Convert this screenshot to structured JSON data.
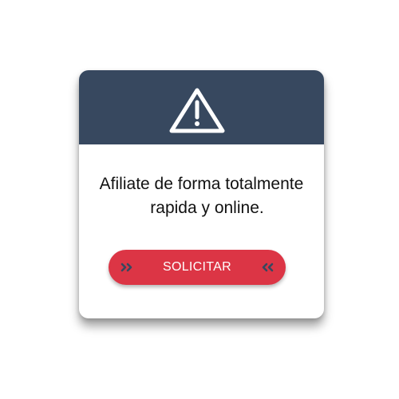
{
  "dialog": {
    "header_icon": "warning-triangle-icon",
    "message_line1": "Afiliate de forma totalmente",
    "message_line2": "rapida y online.",
    "button_label": "SOLICITAR",
    "button_icon_left": "double-chevron-right-icon",
    "button_icon_right": "double-chevron-left-icon"
  },
  "colors": {
    "header_background": "#37485f",
    "button_background": "#dc3545",
    "button_chevrons": "#37485f",
    "card_background": "#ffffff"
  }
}
